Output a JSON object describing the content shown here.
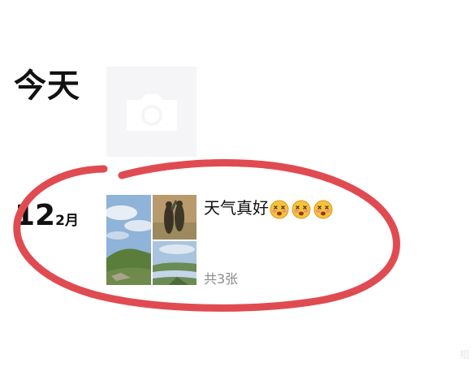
{
  "today_title": "今天",
  "post": {
    "day": "12",
    "month": "2月",
    "text": "天气真好",
    "emoji": [
      "dizzy-face-emoji",
      "dizzy-face-emoji",
      "dizzy-face-emoji"
    ],
    "photo_count": "共3张"
  },
  "annotation_color": "#e04b52",
  "watermark": "相"
}
